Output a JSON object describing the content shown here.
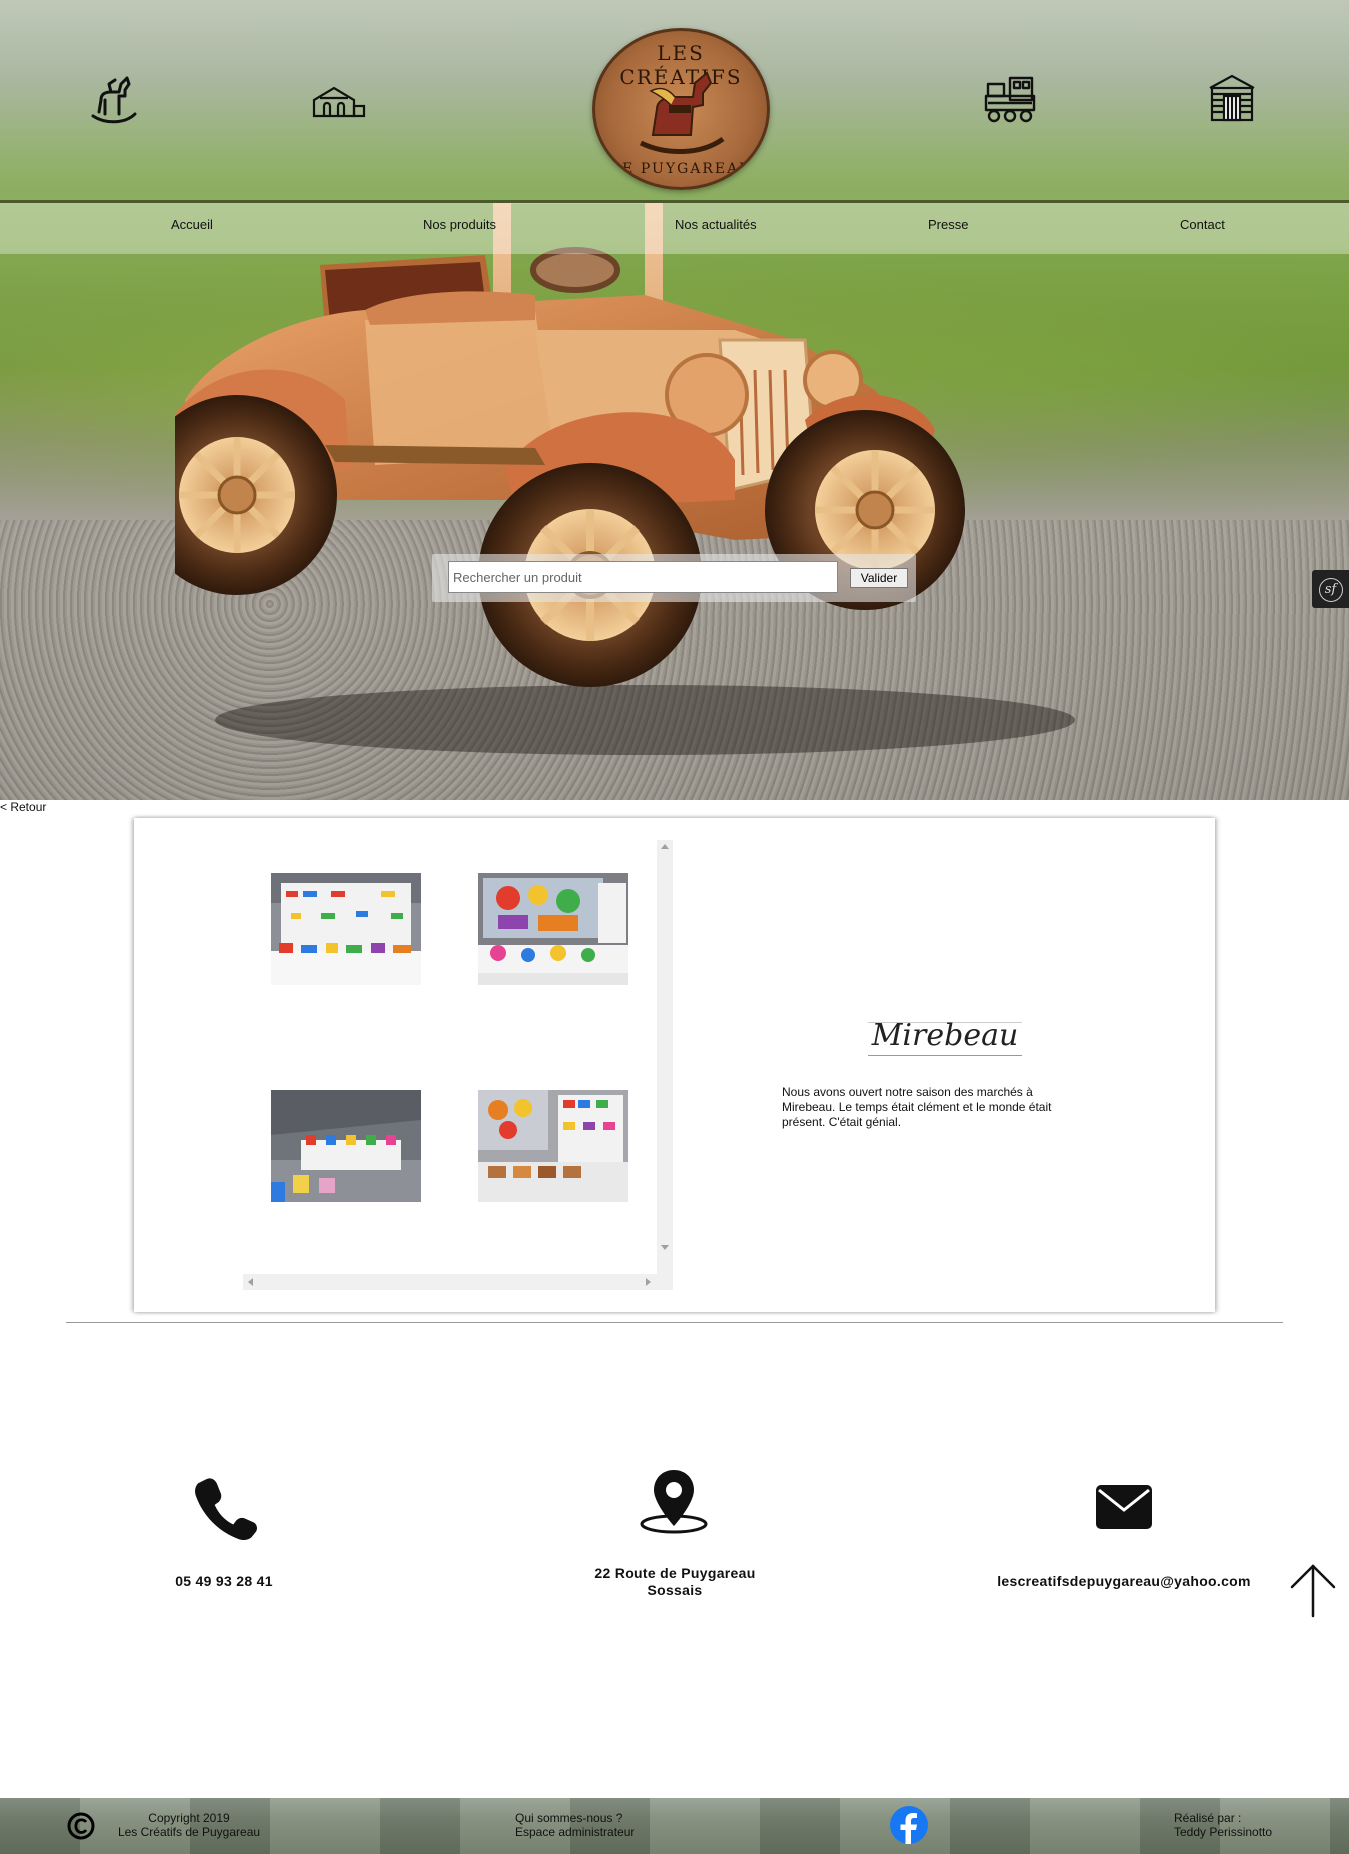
{
  "logo": {
    "top_text": "LES CRÉATIFS",
    "bottom_text": "DE PUYGAREAU"
  },
  "nav": {
    "icons": [
      "rocking-horse-icon",
      "building-blocks-icon",
      "train-icon",
      "wooden-house-icon"
    ],
    "links": [
      "Accueil",
      "Nos produits",
      "Nos actualités",
      "Presse",
      "Contact"
    ]
  },
  "search": {
    "placeholder": "Rechercher un produit",
    "button_label": "Valider"
  },
  "symfony_toolbar": {
    "glyph": "sf"
  },
  "back": {
    "label": "< Retour"
  },
  "event": {
    "title": "Mirebeau",
    "description": "Nous avons ouvert notre saison des marchés à Mirebeau. Le temps était clément et le monde était présent. C'était génial.",
    "photos": [
      "market-stand-photo",
      "market-stand-photo",
      "market-stand-photo",
      "market-stand-photo"
    ]
  },
  "contact": {
    "phone": "05 49 93 28 41",
    "address_line1": "22 Route de Puygareau",
    "address_line2": "Sossais",
    "email": "lescreatifsdepuygareau@yahoo.com"
  },
  "footer": {
    "copyright_line1": "Copyright 2019",
    "copyright_line2": "Les Créatifs de Puygareau",
    "about_link": "Qui sommes-nous ?",
    "admin_link": "Espace administrateur",
    "credit_line1": "Réalisé par :",
    "credit_line2": "Teddy Perissinotto"
  },
  "colors": {
    "accent_line": "#4a5a2a",
    "facebook": "#1877f2",
    "wood": "#b4723e"
  }
}
